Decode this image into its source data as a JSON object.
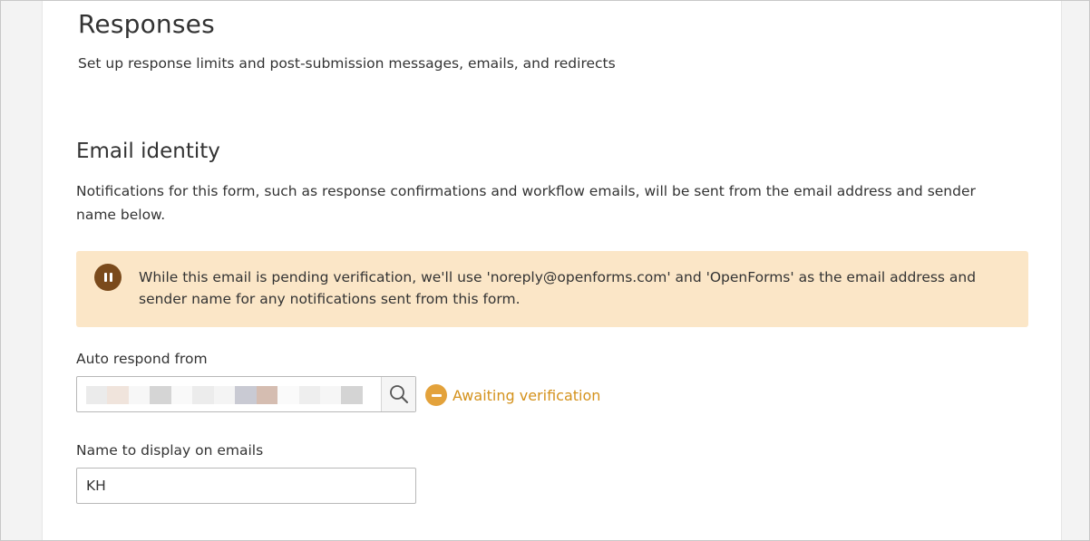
{
  "page": {
    "title": "Responses",
    "subtitle": "Set up response limits and post-submission messages, emails, and redirects"
  },
  "email_identity": {
    "title": "Email identity",
    "description": "Notifications for this form, such as response confirmations and workflow emails, will be sent from the email address and sender name below.",
    "notice": {
      "icon": "pause-icon",
      "text": "While this email is pending verification, we'll use 'noreply@openforms.com' and 'OpenForms' as the email address and sender name for any notifications sent from this form."
    },
    "auto_respond": {
      "label": "Auto respond from",
      "search_icon": "search-icon",
      "status_icon": "minus-circle-icon",
      "status_text": "Awaiting verification"
    },
    "display_name": {
      "label": "Name to display on emails",
      "value": "KH"
    }
  },
  "colors": {
    "notice_background": "#fbe6c7",
    "notice_icon": "#7a4a1c",
    "status_accent": "#e3a23b",
    "status_text": "#d4921c"
  },
  "redacted_email_blocks": [
    "#ebebeb",
    "#f0e4dc",
    "#f7f7f7",
    "#d5d5d5",
    "#f9f9f9",
    "#ececec",
    "#f4f4f4",
    "#c9cad3",
    "#d5bdb1",
    "#fafafa",
    "#eeeeee",
    "#f6f6f6",
    "#d4d4d4"
  ]
}
